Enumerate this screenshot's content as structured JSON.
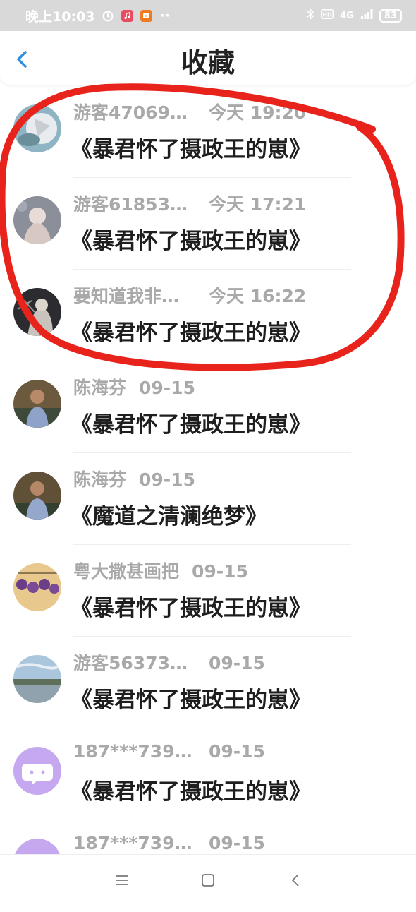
{
  "status_bar": {
    "time": "晚上10:03",
    "network": "4G",
    "battery": "83"
  },
  "header": {
    "title": "收藏"
  },
  "items": [
    {
      "user": "游客47069…",
      "time": "今天 19:20",
      "title": "《暴君怀了摄政王的崽》"
    },
    {
      "user": "游客61853…",
      "time": "今天 17:21",
      "title": "《暴君怀了摄政王的崽》"
    },
    {
      "user": "要知道我非…",
      "time": "今天 16:22",
      "title": "《暴君怀了摄政王的崽》"
    },
    {
      "user": "陈海芬",
      "time": "09-15",
      "title": "《暴君怀了摄政王的崽》"
    },
    {
      "user": "陈海芬",
      "time": "09-15",
      "title": "《魔道之清澜绝梦》"
    },
    {
      "user": "粤大撒甚画把",
      "time": "09-15",
      "title": "《暴君怀了摄政王的崽》"
    },
    {
      "user": "游客56373…",
      "time": "09-15",
      "title": "《暴君怀了摄政王的崽》"
    },
    {
      "user": "187***739…",
      "time": "09-15",
      "title": "《暴君怀了摄政王的崽》"
    },
    {
      "user": "187***739…",
      "time": "09-15",
      "title": ""
    }
  ],
  "colors": {
    "accent": "#2f8fe0",
    "annotation": "#e8231b",
    "meta_text": "#a9a9a9"
  },
  "icons": {
    "back": "chevron-left-icon",
    "menu": "menu-icon",
    "home": "square-icon",
    "back_nav": "back-triangle-icon"
  }
}
